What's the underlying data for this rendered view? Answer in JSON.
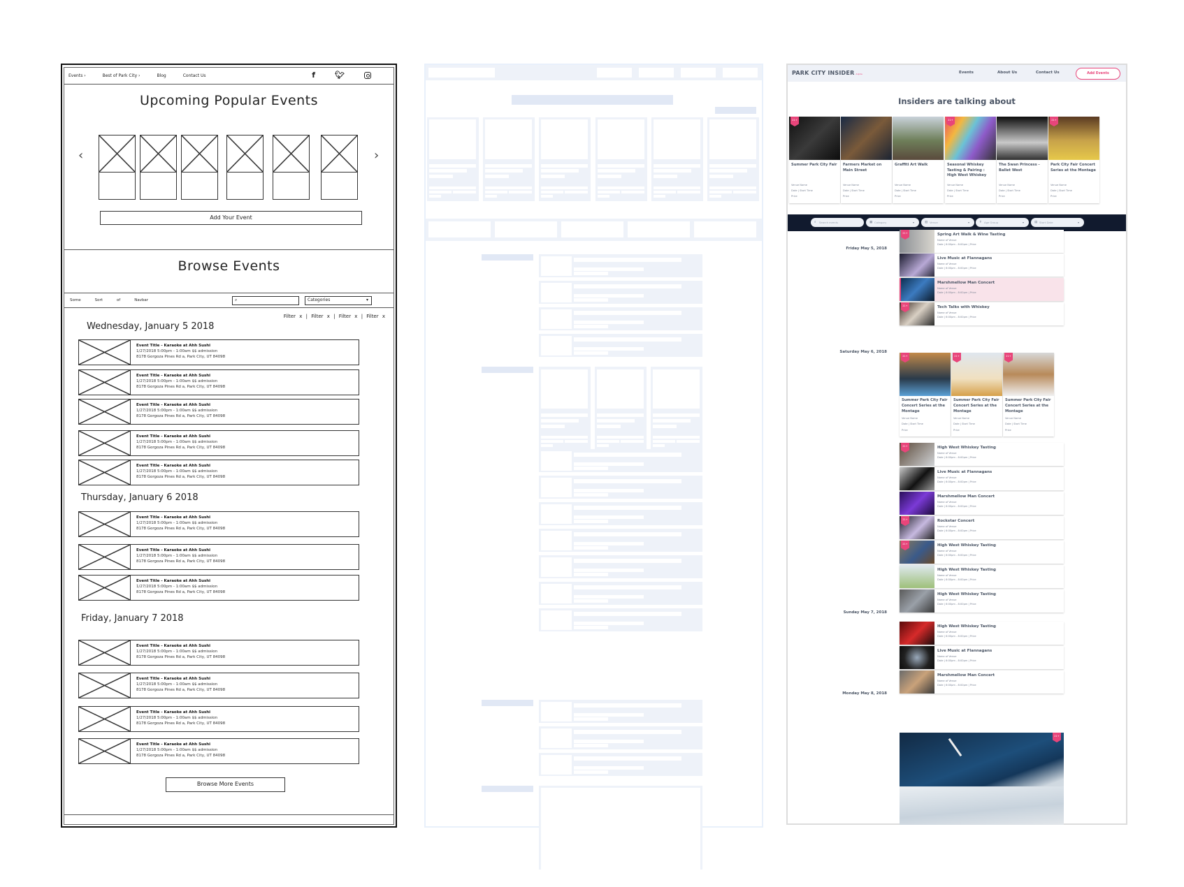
{
  "wireframe": {
    "nav": [
      "Events ›",
      "Best of Park City ›",
      "Blog",
      "Contact Us"
    ],
    "social_icons": [
      "facebook-icon",
      "twitter-icon",
      "instagram-icon"
    ],
    "popular_title": "Upcoming Popular Events",
    "carousel_prev": "‹",
    "carousel_next": "›",
    "carousel_count": 6,
    "add_event_label": "Add Your Event",
    "browse_title": "Browse Events",
    "subnav": [
      "Some",
      "Sort",
      "of",
      "Navbar"
    ],
    "search_icon": "⌕",
    "categories_label": "Categories",
    "filters": [
      "Filter x",
      "Filter x",
      "Filter x",
      "Filter x"
    ],
    "event": {
      "title": "Event Title - Karaoke at Ahh Sushi",
      "when": "1/27/2018    5:00pm - 1:00am    $$ admission",
      "address": "8178 Gorgoza Pines Rd a, Park City, UT 84098"
    },
    "days": [
      {
        "label": "Wednesday, January 5 2018",
        "count": 5
      },
      {
        "label": "Thursday, January 6 2018",
        "count": 3
      },
      {
        "label": "Friday, January 7 2018",
        "count": 4
      }
    ],
    "browse_more_label": "Browse More Events"
  },
  "hifi": {
    "logo": "PARK CITY INSIDER",
    "logo_tag": "Alpha",
    "nav": [
      "Events",
      "About Us",
      "Contact Us"
    ],
    "add_events_label": "Add Events",
    "section_title": "Insiders are talking about",
    "badge": "21+",
    "popular": [
      {
        "title": "Summer Park City Fair",
        "badge": true
      },
      {
        "title": "Farmers Market on Main Street",
        "badge": false
      },
      {
        "title": "Graffiti Art Walk",
        "badge": false
      },
      {
        "title": "Seasonal Whiskey Tasting & Pairing : High West Whiskey",
        "badge": true
      },
      {
        "title": "The Swan Princess - Ballet West",
        "badge": false
      },
      {
        "title": "Park City Fair Concert Series at the Montage",
        "badge": true
      }
    ],
    "card_meta": {
      "venue": "Venue Name",
      "date_time": "Date  |  Start Time",
      "price": "Price"
    },
    "filters": [
      {
        "icon": "search-icon",
        "glyph": "⌕",
        "label": "Search events"
      },
      {
        "icon": "category-icon",
        "glyph": "▦",
        "label": "Category"
      },
      {
        "icon": "venue-icon",
        "glyph": "▥",
        "label": "Venue"
      },
      {
        "icon": "age-group-icon",
        "glyph": "✝",
        "label": "Age Group"
      },
      {
        "icon": "calendar-icon",
        "glyph": "▤",
        "label": "Start Date"
      }
    ],
    "row_meta": {
      "venue": "Name of Venue",
      "when": "Date  |  6:00pm - 8:00pm  |  Price"
    },
    "days": [
      {
        "label": "Friday May 5, 2018",
        "rows": [
          {
            "title": "Spring Art Walk & Wine Tasting",
            "badge": true
          },
          {
            "title": "Live Music at Flannagans",
            "badge": false
          },
          {
            "title": "Marshmellow Man Concert",
            "badge": false,
            "highlight": true
          },
          {
            "title": "Tech Talks with Whiskey",
            "badge": true
          }
        ]
      },
      {
        "label": "Saturday May 6, 2018",
        "cards": [
          {
            "title": "Summer Park City Fair Concert Series at the Montage",
            "badge": true
          },
          {
            "title": "Summer Park City Fair Concert Series at the Montage",
            "badge": true
          },
          {
            "title": "Summer Park City Fair Concert Series at the Montage",
            "badge": true
          }
        ],
        "rows": [
          {
            "title": "High West Whiskey Tasting",
            "badge": true
          },
          {
            "title": "Live Music at Flannagans",
            "badge": false
          },
          {
            "title": "Marshmellow Man Concert",
            "badge": false
          },
          {
            "title": "Rockstar Concert",
            "badge": true
          },
          {
            "title": "High West Whiskey Tasting",
            "badge": true
          },
          {
            "title": "High West Whiskey Tasting",
            "badge": false
          },
          {
            "title": "High West Whiskey Tasting",
            "badge": false
          }
        ]
      },
      {
        "label": "Sunday May 7, 2018",
        "rows": [
          {
            "title": "High West Whiskey Tasting",
            "badge": false
          },
          {
            "title": "Live Music at Flannagans",
            "badge": false
          },
          {
            "title": "Marshmellow Man Concert",
            "badge": false
          }
        ]
      },
      {
        "label": "Monday May 8, 2018",
        "hero_badge": true
      }
    ],
    "colors": {
      "accent": "#e8457a",
      "filter_bar": "#111a2e",
      "header_bg": "#eef1f7",
      "text": "#4b5565",
      "highlight_row": "#f9e3ea"
    }
  }
}
